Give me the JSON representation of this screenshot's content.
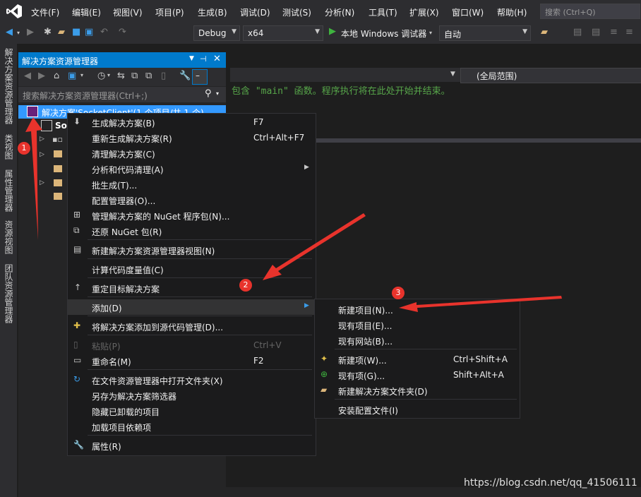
{
  "menubar": {
    "items": [
      "文件(F)",
      "编辑(E)",
      "视图(V)",
      "项目(P)",
      "生成(B)",
      "调试(D)",
      "测试(S)",
      "分析(N)",
      "工具(T)",
      "扩展(X)",
      "窗口(W)",
      "帮助(H)"
    ],
    "search_placeholder": "搜索 (Ctrl+Q)"
  },
  "toolbar": {
    "config": "Debug",
    "platform": "x64",
    "run_label": "本地 Windows 调试器",
    "run_mode": "自动"
  },
  "side_tabs": [
    "解决方案资源管理器",
    "类视图",
    "属性管理器",
    "资源视图",
    "团队资源管理器"
  ],
  "solution_explorer": {
    "title": "解决方案资源管理器",
    "search_placeholder": "搜索解决方案资源管理器(Ctrl+;)",
    "selected_node": "解决方案",
    "selected_node_rest": "'SocketClient'(1 个项目/共 1 个)",
    "project_node": "Soc"
  },
  "editor": {
    "scope": "(全局范围)",
    "comment": "包含 \"main\" 函数。程序执行将在此处开始并结束。"
  },
  "context_menu": {
    "items": [
      {
        "label": "生成解决方案(B)",
        "shortcut": "F7",
        "icon": "build-icon"
      },
      {
        "label": "重新生成解决方案(R)",
        "shortcut": "Ctrl+Alt+F7"
      },
      {
        "label": "清理解决方案(C)",
        "shortcut": ""
      },
      {
        "label": "分析和代码清理(A)",
        "shortcut": ""
      },
      {
        "label": "批生成(T)...",
        "shortcut": ""
      },
      {
        "label": "配置管理器(O)...",
        "shortcut": ""
      },
      {
        "label": "管理解决方案的 NuGet 程序包(N)...",
        "shortcut": "",
        "icon": "nuget-icon"
      },
      {
        "label": "还原 NuGet 包(R)",
        "shortcut": "",
        "icon": "restore-icon"
      },
      {
        "label": "新建解决方案资源管理器视图(N)",
        "shortcut": "",
        "icon": "new-view-icon"
      },
      {
        "label": "计算代码度量值(C)",
        "shortcut": ""
      },
      {
        "label": "重定目标解决方案",
        "shortcut": "",
        "icon": "arrow-up-icon"
      },
      {
        "label": "添加(D)",
        "shortcut": ""
      },
      {
        "label": "将解决方案添加到源代码管理(D)...",
        "shortcut": "",
        "icon": "source-control-icon"
      },
      {
        "label": "粘贴(P)",
        "shortcut": "Ctrl+V",
        "icon": "paste-icon"
      },
      {
        "label": "重命名(M)",
        "shortcut": "F2",
        "icon": "rename-icon"
      },
      {
        "label": "在文件资源管理器中打开文件夹(X)",
        "shortcut": "",
        "icon": "refresh-icon"
      },
      {
        "label": "另存为解决方案筛选器",
        "shortcut": ""
      },
      {
        "label": "隐藏已卸载的项目",
        "shortcut": ""
      },
      {
        "label": "加载项目依赖项",
        "shortcut": ""
      },
      {
        "label": "属性(R)",
        "shortcut": "",
        "icon": "wrench-icon"
      }
    ]
  },
  "add_submenu": {
    "items": [
      {
        "label": "新建项目(N)...",
        "shortcut": ""
      },
      {
        "label": "现有项目(E)...",
        "shortcut": ""
      },
      {
        "label": "现有网站(B)...",
        "shortcut": ""
      },
      {
        "label": "新建项(W)...",
        "shortcut": "Ctrl+Shift+A",
        "icon": "new-item-icon"
      },
      {
        "label": "现有项(G)...",
        "shortcut": "Shift+Alt+A",
        "icon": "existing-item-icon"
      },
      {
        "label": "新建解决方案文件夹(D)",
        "shortcut": "",
        "icon": "new-folder-icon"
      },
      {
        "label": "安装配置文件(I)",
        "shortcut": ""
      }
    ]
  },
  "annotations": [
    "1",
    "2",
    "3"
  ],
  "watermark": "https://blog.csdn.net/qq_41506111",
  "colors": {
    "accent": "#007acc",
    "arrow": "#e8332c",
    "comment": "#57a64a"
  }
}
